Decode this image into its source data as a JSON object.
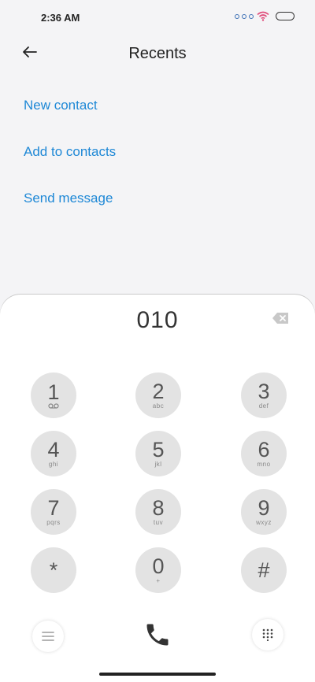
{
  "status": {
    "time": "2:36 AM"
  },
  "header": {
    "title": "Recents"
  },
  "actions": {
    "new_contact": "New contact",
    "add_to_contacts": "Add to contacts",
    "send_message": "Send message"
  },
  "dialer": {
    "number": "010",
    "keys": [
      {
        "digit": "1",
        "letters": ""
      },
      {
        "digit": "2",
        "letters": "abc"
      },
      {
        "digit": "3",
        "letters": "def"
      },
      {
        "digit": "4",
        "letters": "ghi"
      },
      {
        "digit": "5",
        "letters": "jkl"
      },
      {
        "digit": "6",
        "letters": "mno"
      },
      {
        "digit": "7",
        "letters": "pqrs"
      },
      {
        "digit": "8",
        "letters": "tuv"
      },
      {
        "digit": "9",
        "letters": "wxyz"
      },
      {
        "digit": "*",
        "letters": ""
      },
      {
        "digit": "0",
        "letters": "+"
      },
      {
        "digit": "#",
        "letters": ""
      }
    ]
  },
  "colors": {
    "accent": "#1e88d6",
    "background": "#f4f4f6",
    "key": "#e3e3e3"
  },
  "icons": {
    "back": "arrow-left-icon",
    "backspace": "backspace-icon",
    "voicemail": "voicemail-icon",
    "menu": "menu-icon",
    "call": "phone-icon",
    "keypad": "keypad-icon",
    "wifi": "wifi-icon",
    "battery": "battery-icon"
  }
}
